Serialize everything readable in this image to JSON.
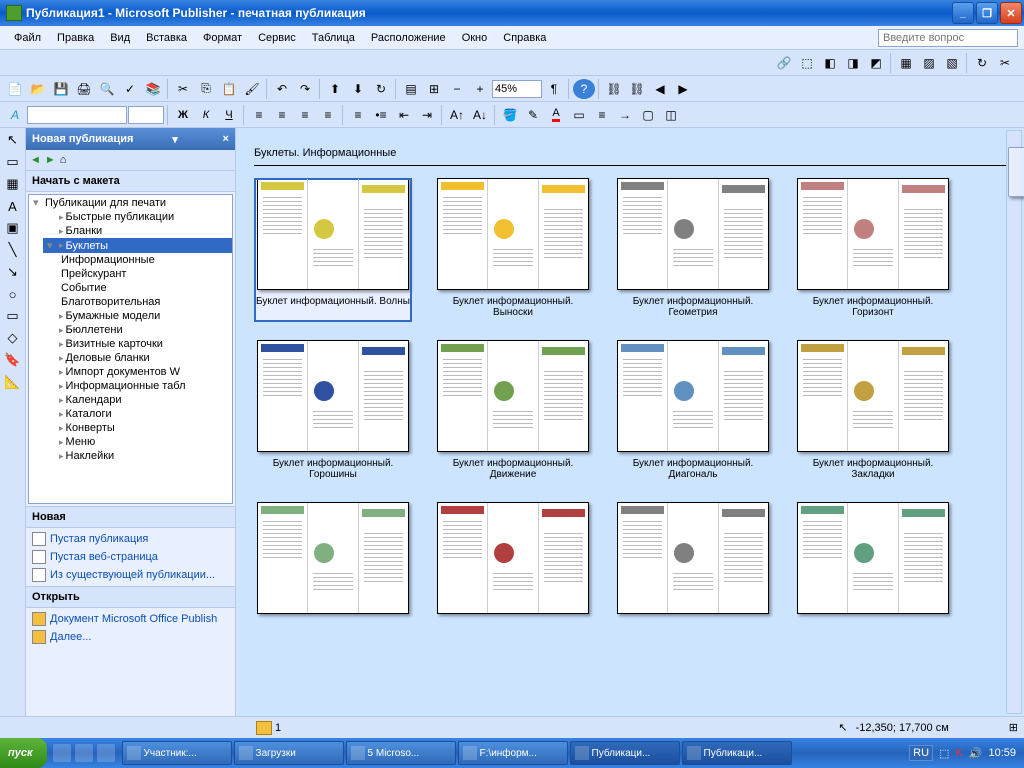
{
  "title": "Публикация1 - Microsoft Publisher - печатная публикация",
  "menus": [
    "Файл",
    "Правка",
    "Вид",
    "Вставка",
    "Формат",
    "Сервис",
    "Таблица",
    "Расположение",
    "Окно",
    "Справка"
  ],
  "help_placeholder": "Введите вопрос",
  "zoom": "45%",
  "taskpane": {
    "title": "Новая публикация",
    "section_start": "Начать с макета",
    "section_new": "Новая",
    "section_open": "Открыть",
    "tree": [
      {
        "lvl": 0,
        "label": "Публикации для печати",
        "expanded": true
      },
      {
        "lvl": 1,
        "label": "Быстрые публикации"
      },
      {
        "lvl": 1,
        "label": "Бланки"
      },
      {
        "lvl": 1,
        "label": "Буклеты",
        "expanded": true,
        "selected": true
      },
      {
        "lvl": 2,
        "label": "Информационные"
      },
      {
        "lvl": 2,
        "label": "Прейскурант"
      },
      {
        "lvl": 2,
        "label": "Событие"
      },
      {
        "lvl": 2,
        "label": "Благотворительная"
      },
      {
        "lvl": 1,
        "label": "Бумажные модели"
      },
      {
        "lvl": 1,
        "label": "Бюллетени"
      },
      {
        "lvl": 1,
        "label": "Визитные карточки"
      },
      {
        "lvl": 1,
        "label": "Деловые бланки"
      },
      {
        "lvl": 1,
        "label": "Импорт документов W"
      },
      {
        "lvl": 1,
        "label": "Информационные табл"
      },
      {
        "lvl": 1,
        "label": "Календари"
      },
      {
        "lvl": 1,
        "label": "Каталоги"
      },
      {
        "lvl": 1,
        "label": "Конверты"
      },
      {
        "lvl": 1,
        "label": "Меню"
      },
      {
        "lvl": 1,
        "label": "Наклейки"
      }
    ],
    "new_links": [
      "Пустая публикация",
      "Пустая веб-страница",
      "Из существующей публикации..."
    ],
    "open_links": [
      "Документ Microsoft Office Publish",
      "Далее..."
    ]
  },
  "gallery": {
    "heading": "Буклеты. Информационные",
    "templates": [
      {
        "label": "Буклет информационный. Волны",
        "selected": true
      },
      {
        "label": "Буклет информационный. Выноски"
      },
      {
        "label": "Буклет информационный. Геометрия"
      },
      {
        "label": "Буклет информационный. Горизонт"
      },
      {
        "label": "Буклет информационный. Горошины"
      },
      {
        "label": "Буклет информационный. Движение"
      },
      {
        "label": "Буклет информационный. Диагональ"
      },
      {
        "label": "Буклет информационный. Закладки"
      },
      {
        "label": ""
      },
      {
        "label": ""
      },
      {
        "label": ""
      },
      {
        "label": ""
      }
    ]
  },
  "status": {
    "page": "1",
    "coords": "-12,350; 17,700 см"
  },
  "taskbar": {
    "start": "пуск",
    "tasks": [
      "Участник:...",
      "Загрузки",
      "5 Microso...",
      "F:\\информ...",
      "Публикаци...",
      "Публикаци..."
    ],
    "lang": "RU",
    "clock": "10:59"
  }
}
